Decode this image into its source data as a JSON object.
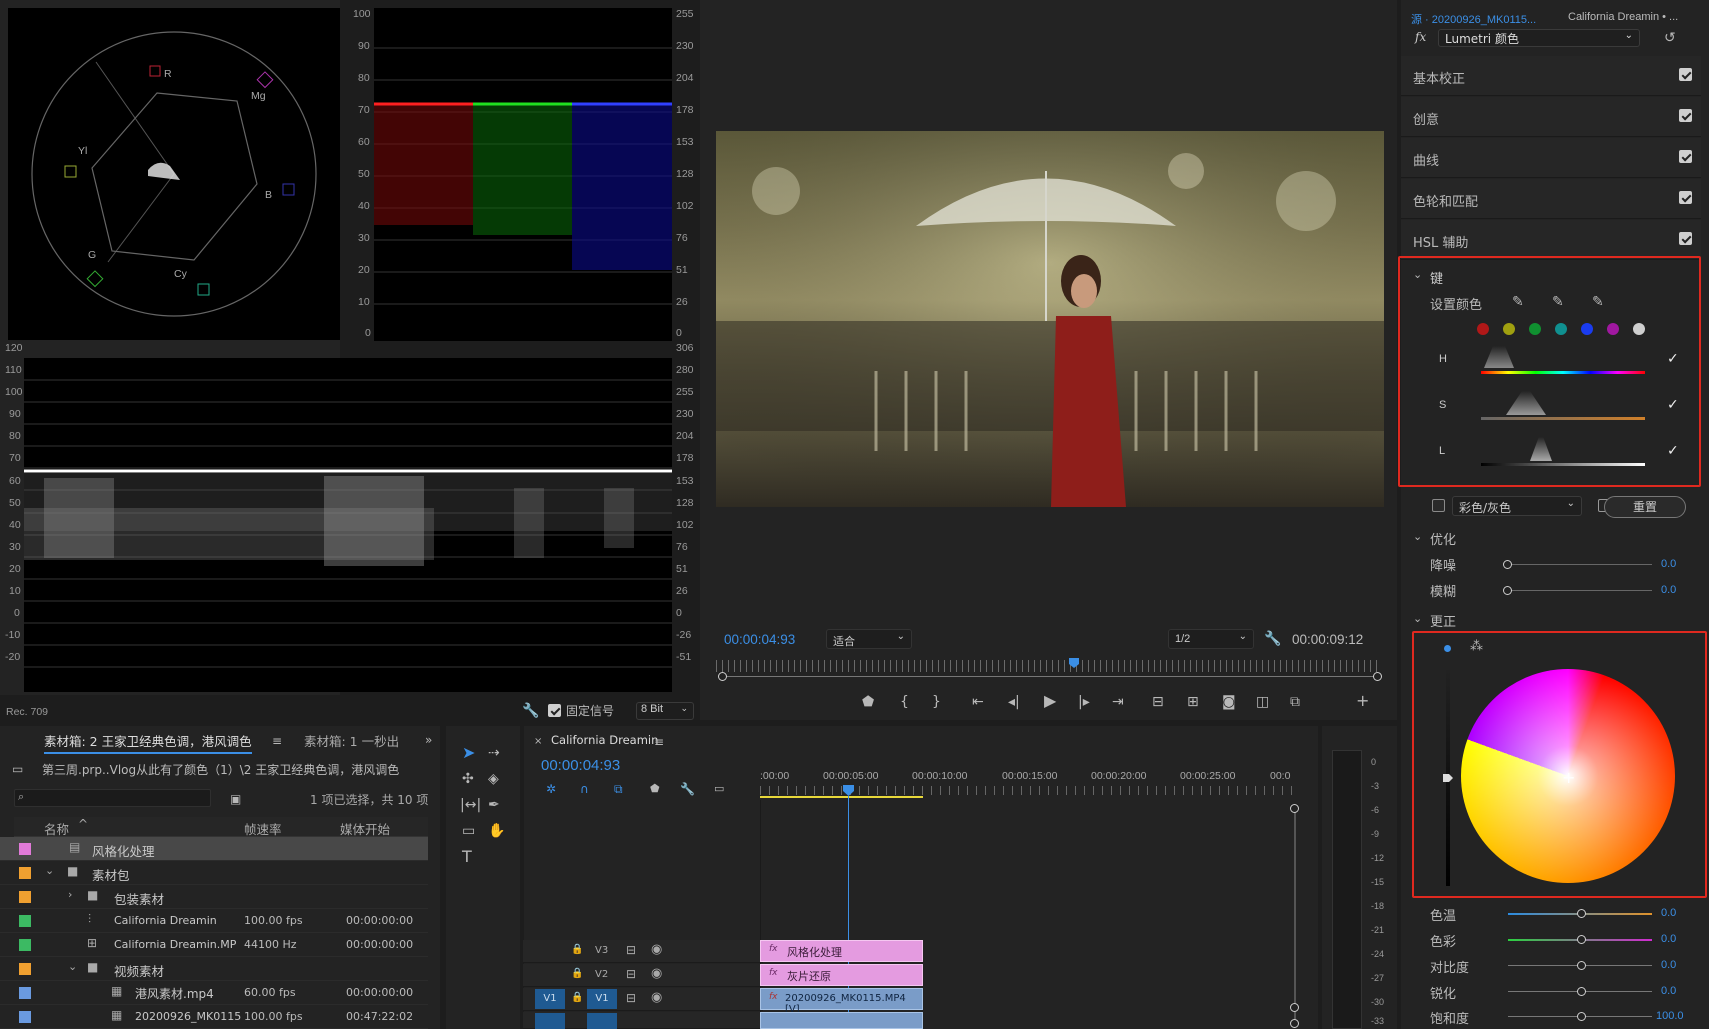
{
  "vectorscope": {
    "labels": [
      "R",
      "Mg",
      "B",
      "Cy",
      "G",
      "Yl"
    ],
    "footer": "Rec. 709"
  },
  "rgb_parade": {
    "left_ticks": [
      "100",
      "90",
      "80",
      "70",
      "60",
      "50",
      "40",
      "30",
      "20",
      "10",
      "0"
    ],
    "right_ticks": [
      "255",
      "230",
      "204",
      "178",
      "153",
      "128",
      "102",
      "76",
      "51",
      "26",
      "0"
    ]
  },
  "waveform": {
    "left_ticks": [
      "120",
      "110",
      "100",
      "90",
      "80",
      "70",
      "60",
      "50",
      "40",
      "30",
      "20",
      "10",
      "0",
      "-10",
      "-20"
    ],
    "right_ticks": [
      "306",
      "280",
      "255",
      "230",
      "204",
      "178",
      "153",
      "128",
      "102",
      "76",
      "51",
      "26",
      "0",
      "-26",
      "-51"
    ]
  },
  "scope_footer": {
    "clamp_label": "固定信号",
    "bit_depth": "8 Bit"
  },
  "program": {
    "timecode": "00:00:04:93",
    "fit": "适合",
    "resolution": "1/2",
    "duration": "00:00:09:12"
  },
  "lumetri": {
    "source": "源 · 20200926_MK0115...",
    "sequence": "California Dreamin • ...",
    "fx": "fx",
    "effect": "Lumetri 颜色",
    "sections": [
      "基本校正",
      "创意",
      "曲线",
      "色轮和匹配",
      "HSL 辅助"
    ],
    "key_label": "键",
    "set_color": "设置颜色",
    "h": "H",
    "s": "S",
    "l": "L",
    "mode": "彩色/灰色",
    "reset": "重置",
    "refine": "优化",
    "denoise": "降噪",
    "blur": "模糊",
    "denoise_val": "0.0",
    "blur_val": "0.0",
    "correction": "更正",
    "params": [
      {
        "label": "色温",
        "value": "0.0"
      },
      {
        "label": "色彩",
        "value": "0.0"
      },
      {
        "label": "对比度",
        "value": "0.0"
      },
      {
        "label": "锐化",
        "value": "0.0"
      },
      {
        "label": "饱和度",
        "value": "100.0"
      }
    ],
    "colors": {
      "accent": "#3b8fe6",
      "highlight": "#e0291f"
    }
  },
  "project": {
    "tab_active": "素材箱: 2 王家卫经典色调，港风调色",
    "tab_2": "素材箱: 1 一秒出",
    "path": "第三周.prp..Vlog从此有了颜色（1）\\2 王家卫经典色调，港风调色",
    "selection": "1 项已选择，共 10 项",
    "cols": [
      "名称",
      "帧速率",
      "媒体开始"
    ],
    "rows": [
      {
        "name": "风格化处理",
        "fps": "",
        "start": "",
        "color": "#e07ad8"
      },
      {
        "name": "素材包",
        "fps": "",
        "start": "",
        "color": "#f0a030"
      },
      {
        "name": "包装素材",
        "fps": "",
        "start": "",
        "color": "#f0a030"
      },
      {
        "name": "California Dreamin",
        "fps": "100.00 fps",
        "start": "00:00:00:00",
        "color": "#3cba63"
      },
      {
        "name": "California Dreamin.MP",
        "fps": "44100 Hz",
        "start": "00:00:00:00",
        "color": "#3cba63"
      },
      {
        "name": "视频素材",
        "fps": "",
        "start": "",
        "color": "#f0a030"
      },
      {
        "name": "港风素材.mp4",
        "fps": "60.00 fps",
        "start": "00:00:00:00",
        "color": "#6a9ae0"
      },
      {
        "name": "20200926_MK0115",
        "fps": "100.00 fps",
        "start": "00:47:22:02",
        "color": "#6a9ae0"
      }
    ]
  },
  "timeline": {
    "tab": "California Dreamin",
    "timecode": "00:00:04:93",
    "ruler": [
      ":00:00",
      "00:00:05:00",
      "00:00:10:00",
      "00:00:15:00",
      "00:00:20:00",
      "00:00:25:00",
      "00:0"
    ],
    "tracks": [
      "V3",
      "V2",
      "V1"
    ],
    "clips": [
      "风格化处理",
      "灰片还原",
      "20200926_MK0115.MP4 [V]"
    ],
    "meter": [
      "0",
      "-3",
      "-6",
      "-9",
      "-12",
      "-15",
      "-18",
      "-21",
      "-24",
      "-27",
      "-30",
      "-33"
    ]
  }
}
